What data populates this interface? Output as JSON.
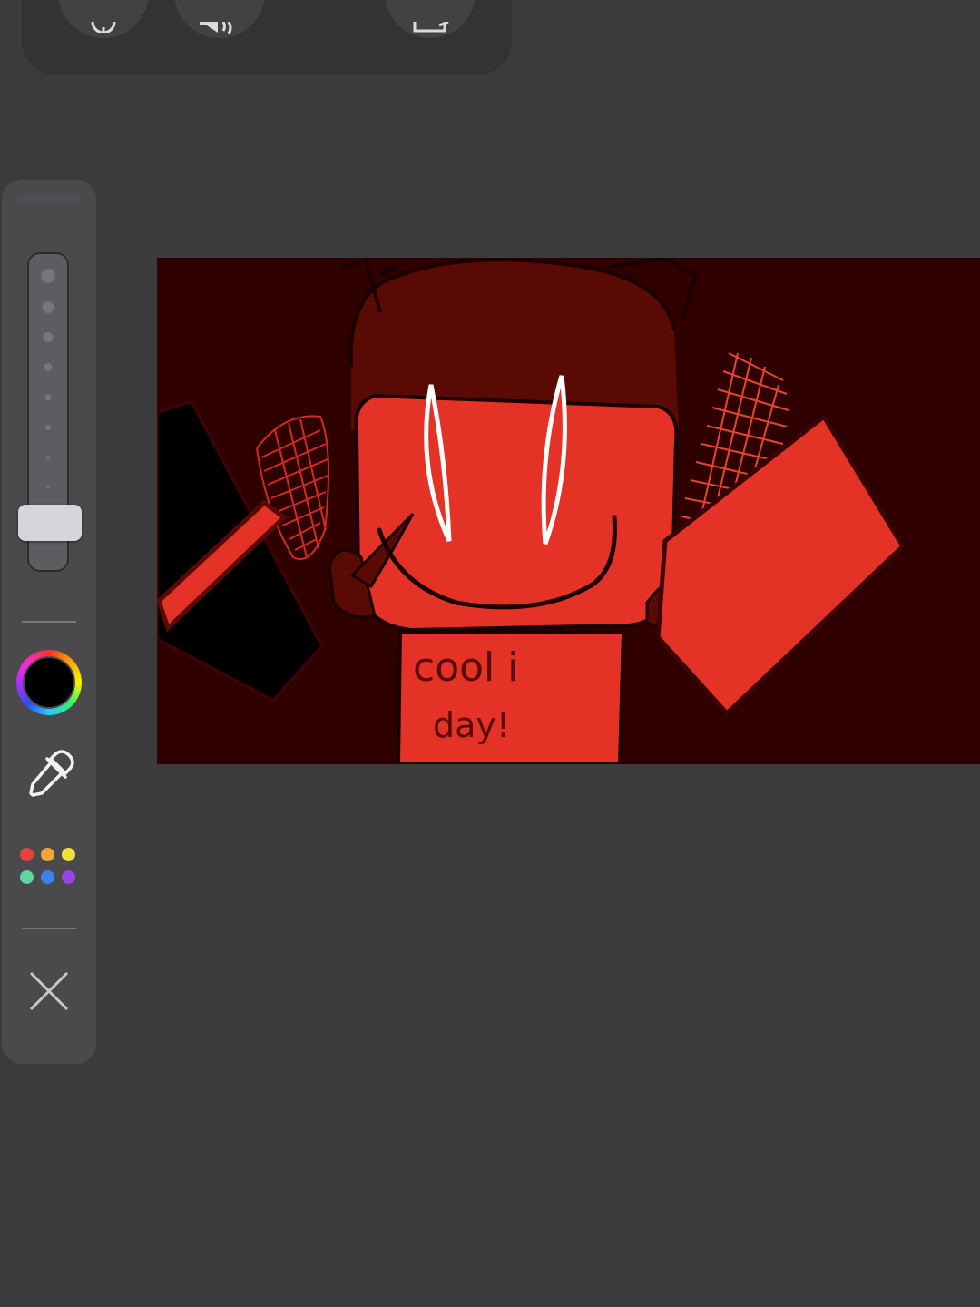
{
  "top_bar": {
    "buttons": [
      {
        "name": "microphone",
        "icon": "microphone-icon"
      },
      {
        "name": "speaker",
        "icon": "speaker-icon"
      },
      {
        "name": "share",
        "icon": "share-icon"
      }
    ]
  },
  "tool_panel": {
    "brush_size_level": 0.07,
    "selected_color": "#000000",
    "tools": [
      {
        "name": "color-picker",
        "icon": "color-wheel-icon"
      },
      {
        "name": "eyedropper",
        "icon": "eyedropper-icon"
      },
      {
        "name": "palette",
        "icon": "palette-icon"
      },
      {
        "name": "close",
        "icon": "close-icon"
      }
    ],
    "palette_colors": [
      "#e8403a",
      "#f2a33a",
      "#f0e03a",
      "#5ed6a0",
      "#3b82f0",
      "#9b42e8"
    ]
  },
  "canvas": {
    "background": "#2e0000",
    "drawing_text": [
      "cool i",
      "day!"
    ],
    "colors": {
      "body_red": "#e43326",
      "dark_red": "#5a0a05",
      "outline": "#1a0000",
      "eye_white": "#ffffff"
    }
  }
}
